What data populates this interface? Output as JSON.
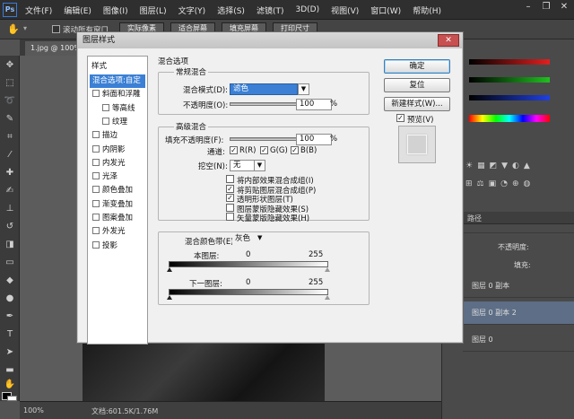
{
  "app": {
    "logo": "Ps"
  },
  "menu": [
    "文件(F)",
    "编辑(E)",
    "图像(I)",
    "图层(L)",
    "文字(Y)",
    "选择(S)",
    "滤镜(T)",
    "3D(D)",
    "视图(V)",
    "窗口(W)",
    "帮助(H)"
  ],
  "optbar": {
    "checkbox_label": "滚动所有窗口",
    "btn1": "实际像素",
    "btn2": "适合屏幕",
    "btn3": "填充屏幕",
    "btn4": "打印尺寸"
  },
  "document": {
    "tab": "1.jpg @ 100%"
  },
  "statusbar": {
    "zoom": "100%",
    "docinfo": "文档:601.5K/1.76M"
  },
  "rightpanel": {
    "tab_layers": "路径",
    "opacity_label": "不透明度:",
    "fill_label": "填充:",
    "layers": [
      {
        "name": "图层 0 副本",
        "selected": false
      },
      {
        "name": "图层 0 副本 2",
        "selected": true
      },
      {
        "name": "图层 0",
        "selected": false
      }
    ]
  },
  "dialog": {
    "title": "图层样式",
    "close": "✕",
    "styles_header": "样式",
    "styles": [
      {
        "label": "混合选项:自定",
        "checkbox": false,
        "selected": true,
        "indent": false
      },
      {
        "label": "斜面和浮雕",
        "checkbox": true,
        "selected": false,
        "indent": false
      },
      {
        "label": "等高线",
        "checkbox": true,
        "selected": false,
        "indent": true
      },
      {
        "label": "纹理",
        "checkbox": true,
        "selected": false,
        "indent": true
      },
      {
        "label": "描边",
        "checkbox": true,
        "selected": false,
        "indent": false
      },
      {
        "label": "内阴影",
        "checkbox": true,
        "selected": false,
        "indent": false
      },
      {
        "label": "内发光",
        "checkbox": true,
        "selected": false,
        "indent": false
      },
      {
        "label": "光泽",
        "checkbox": true,
        "selected": false,
        "indent": false
      },
      {
        "label": "颜色叠加",
        "checkbox": true,
        "selected": false,
        "indent": false
      },
      {
        "label": "渐变叠加",
        "checkbox": true,
        "selected": false,
        "indent": false
      },
      {
        "label": "图案叠加",
        "checkbox": true,
        "selected": false,
        "indent": false
      },
      {
        "label": "外发光",
        "checkbox": true,
        "selected": false,
        "indent": false
      },
      {
        "label": "投影",
        "checkbox": true,
        "selected": false,
        "indent": false
      }
    ],
    "section_title": "混合选项",
    "general": {
      "title": "常规混合",
      "blend_mode_label": "混合模式(D):",
      "blend_mode_value": "滤色",
      "opacity_label": "不透明度(O):",
      "opacity_value": "100",
      "opacity_unit": "%",
      "opacity_level": 1.0
    },
    "advanced": {
      "title": "高级混合",
      "fill_label": "填充不透明度(F):",
      "fill_value": "100",
      "fill_unit": "%",
      "fill_level": 1.0,
      "channels_label": "通道:",
      "channels": [
        {
          "label": "R(R)",
          "checked": true
        },
        {
          "label": "G(G)",
          "checked": true
        },
        {
          "label": "B(B)",
          "checked": true
        }
      ],
      "knockout_label": "挖空(N):",
      "knockout_value": "无",
      "options": [
        {
          "label": "将内部效果混合成组(I)",
          "checked": false
        },
        {
          "label": "将剪贴图层混合成组(P)",
          "checked": true
        },
        {
          "label": "透明形状图层(T)",
          "checked": true
        },
        {
          "label": "图层蒙版隐藏效果(S)",
          "checked": false
        },
        {
          "label": "矢量蒙版隐藏效果(H)",
          "checked": false
        }
      ]
    },
    "blendif": {
      "label": "混合颜色带(E):",
      "value": "灰色",
      "this_layer_label": "本图层:",
      "this_layer_min": "0",
      "this_layer_max": "255",
      "underlying_label": "下一图层:",
      "underlying_min": "0",
      "underlying_max": "255"
    },
    "buttons": {
      "ok": "确定",
      "reset": "复位",
      "new_style": "新建样式(W)...",
      "preview": "预览(V)"
    }
  }
}
